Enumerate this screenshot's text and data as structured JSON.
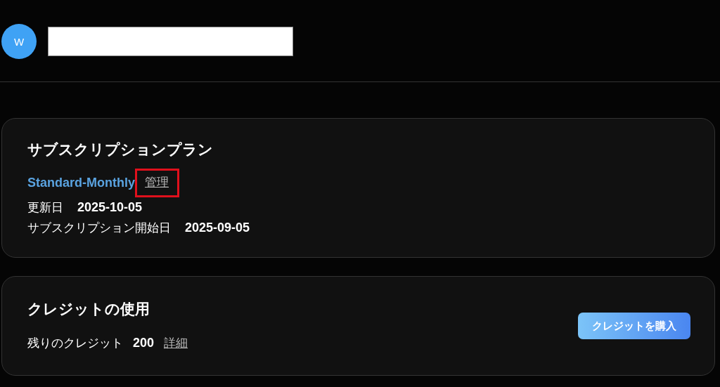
{
  "user": {
    "avatar_initial": "W",
    "name_redacted": true
  },
  "subscription": {
    "title": "サブスクリプションプラン",
    "plan": "Standard-Monthly",
    "manage_link": {
      "label": "管理",
      "highlighted": true
    },
    "details": [
      {
        "label": "更新日",
        "value": "2025-10-05"
      },
      {
        "label": "サブスクリプション開始日",
        "value": "2025-09-05"
      }
    ]
  },
  "credits": {
    "title": "クレジットの使用",
    "remaining_label": "残りのクレジット",
    "remaining_value": "200",
    "details_link": "詳細",
    "buy_button": "クレジットを購入"
  }
}
